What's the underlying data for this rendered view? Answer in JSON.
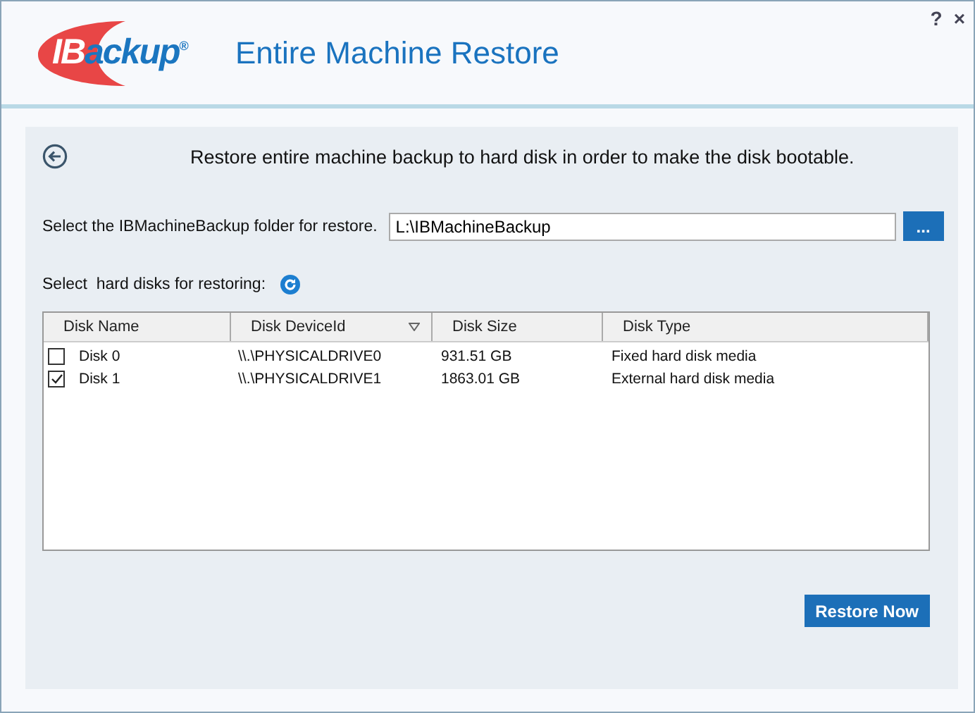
{
  "window": {
    "title": "Entire Machine Restore",
    "help": "?",
    "close": "×"
  },
  "logo": {
    "prefix": "IB",
    "suffix": "ackup",
    "mark": "®"
  },
  "intro": "Restore entire machine backup to hard disk in order to make the disk bootable.",
  "folder": {
    "label": "Select the IBMachineBackup folder for restore.",
    "value": "L:\\IBMachineBackup",
    "browse": "..."
  },
  "disks_label": "Select  hard disks for restoring:",
  "table": {
    "columns": [
      {
        "label": "Disk Name",
        "sorted": false
      },
      {
        "label": "Disk DeviceId",
        "sorted": true
      },
      {
        "label": "Disk Size",
        "sorted": false
      },
      {
        "label": "Disk Type",
        "sorted": false
      }
    ],
    "rows": [
      {
        "checked": false,
        "cells": [
          "Disk 0",
          "\\\\.\\PHYSICALDRIVE0",
          "931.51 GB",
          "Fixed hard disk media"
        ]
      },
      {
        "checked": true,
        "cells": [
          "Disk 1",
          "\\\\.\\PHYSICALDRIVE1",
          "1863.01 GB",
          "External hard disk media"
        ]
      }
    ]
  },
  "buttons": [
    "Restore Now"
  ]
}
